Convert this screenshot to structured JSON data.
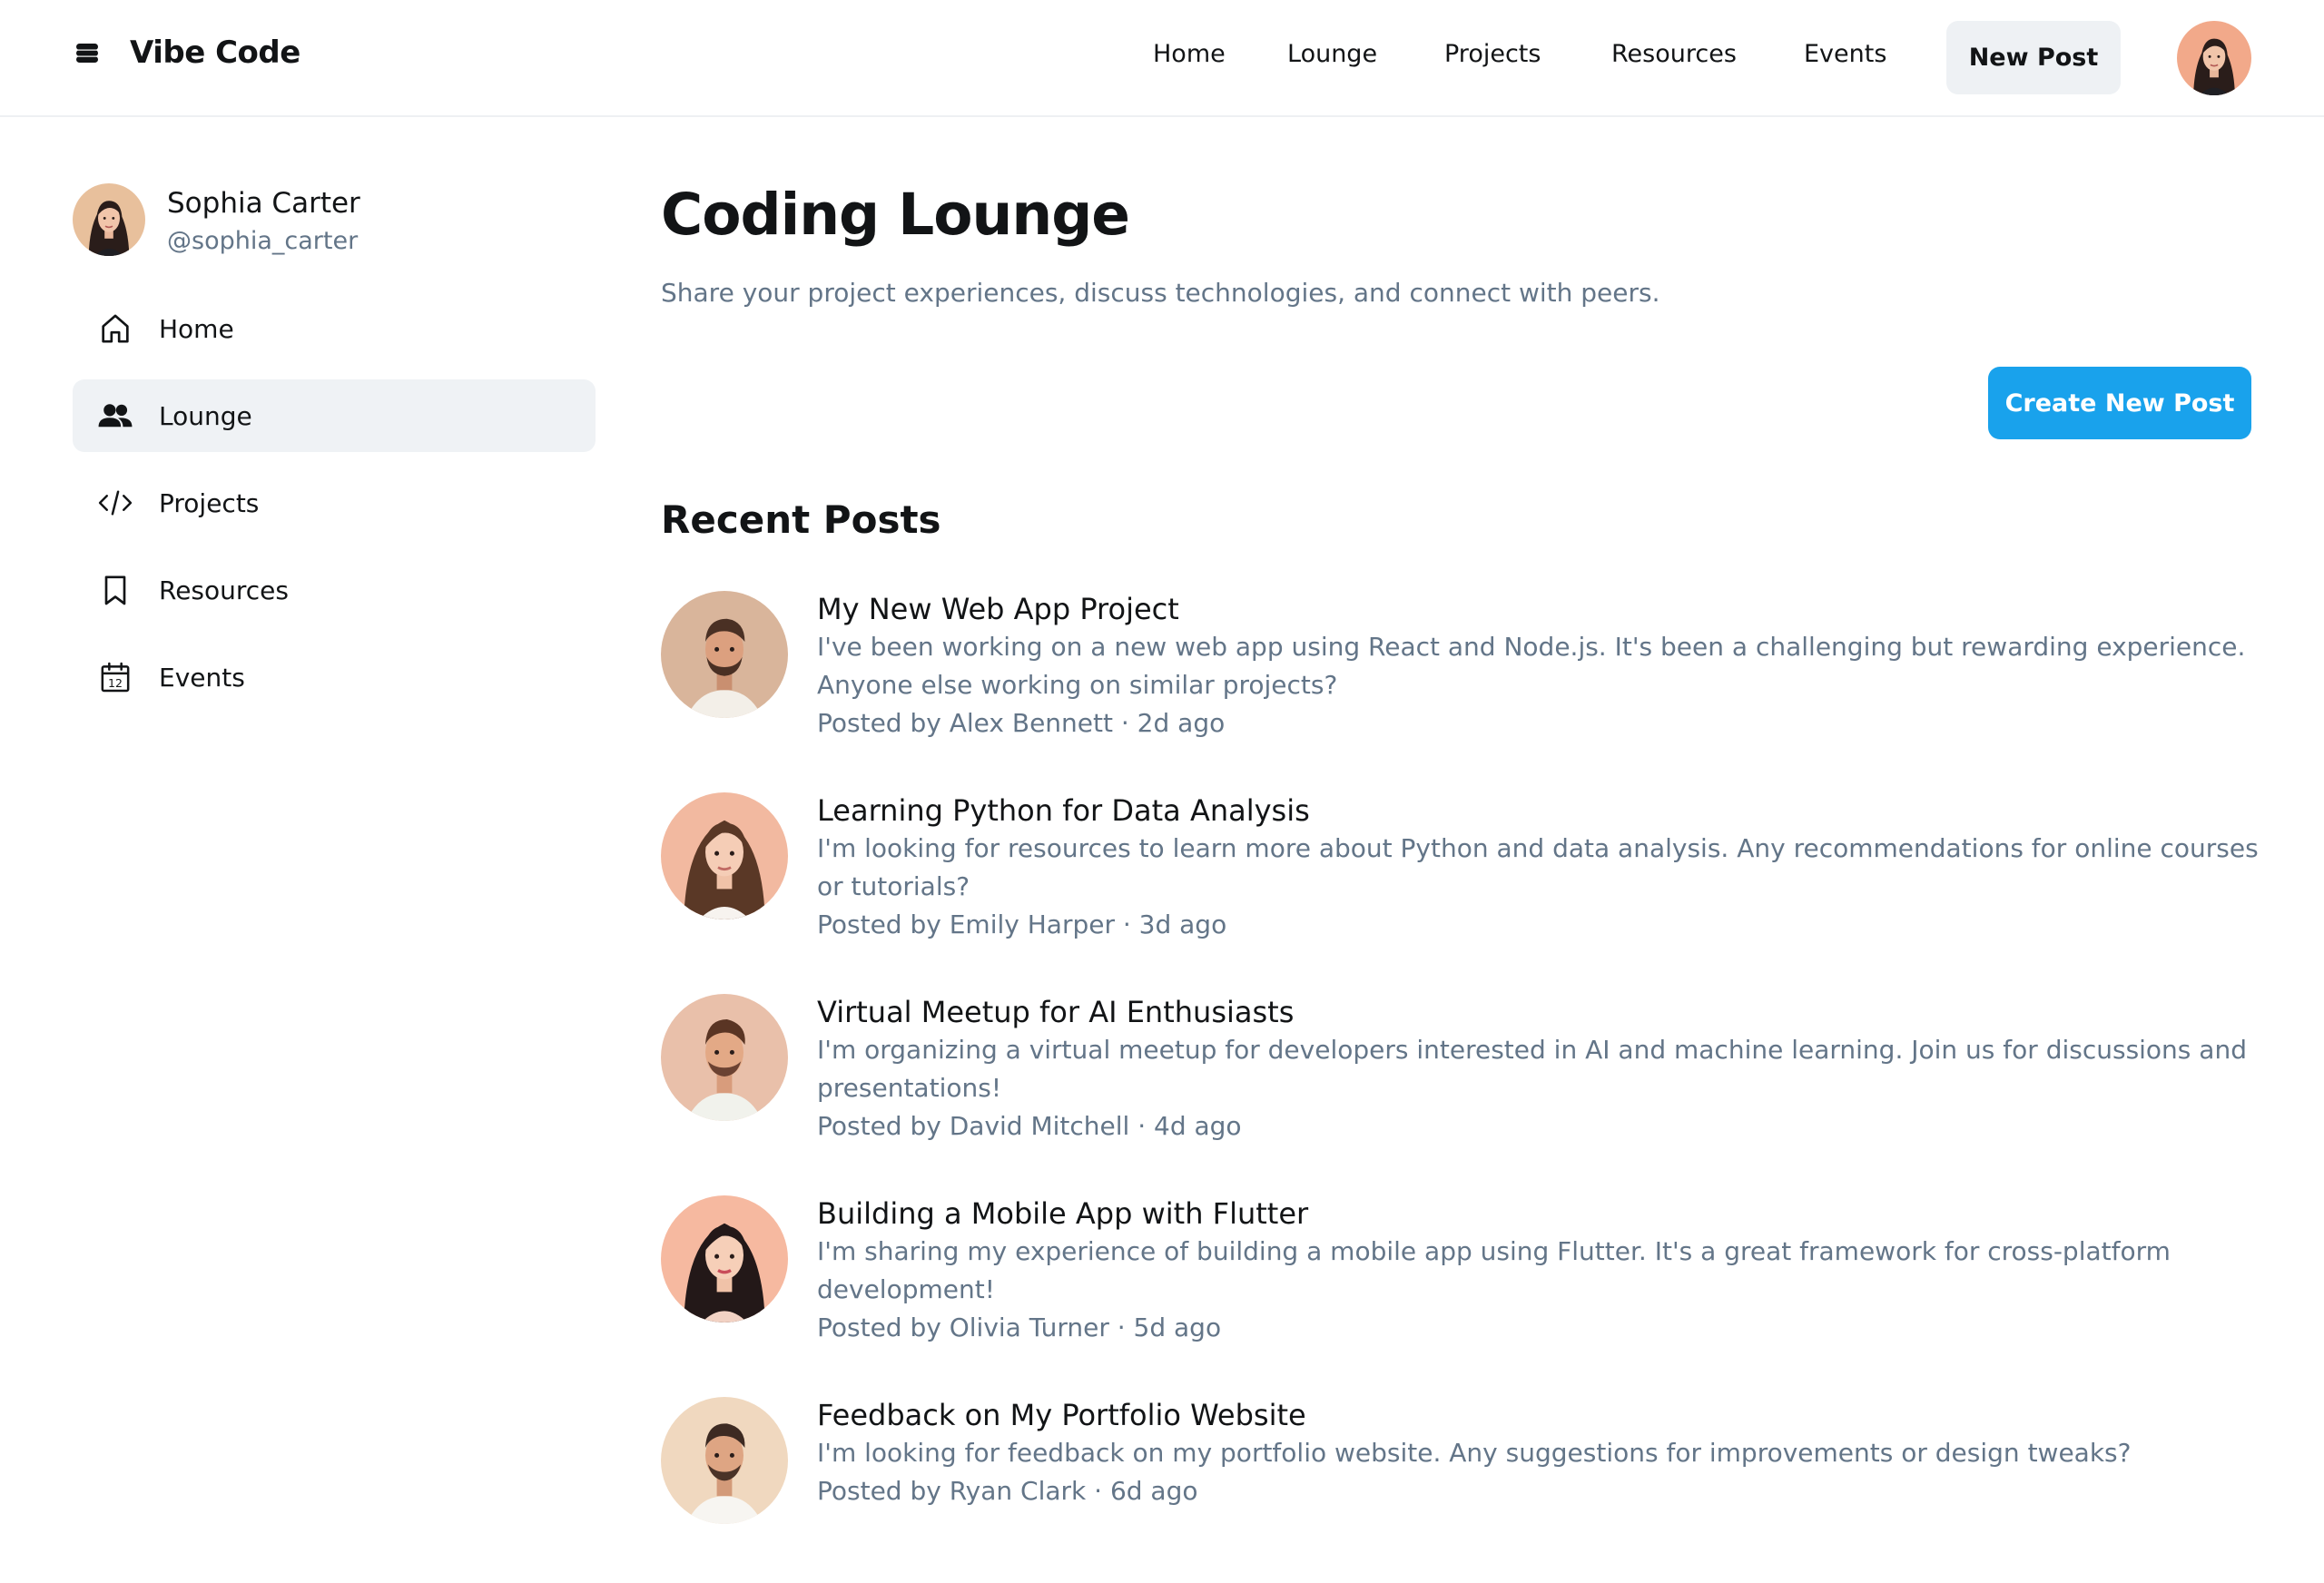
{
  "brand": {
    "name": "Vibe Code"
  },
  "nav": {
    "items": [
      "Home",
      "Lounge",
      "Projects",
      "Resources",
      "Events"
    ],
    "new_post": "New Post"
  },
  "profile": {
    "name": "Sophia Carter",
    "handle": "@sophia_carter"
  },
  "sidebar": {
    "items": [
      {
        "label": "Home",
        "icon": "home-icon"
      },
      {
        "label": "Lounge",
        "icon": "users-icon"
      },
      {
        "label": "Projects",
        "icon": "code-icon"
      },
      {
        "label": "Resources",
        "icon": "bookmark-icon"
      },
      {
        "label": "Events",
        "icon": "calendar-icon",
        "icon_text": "12"
      }
    ],
    "active": "Lounge"
  },
  "main": {
    "title": "Coding Lounge",
    "subtitle": "Share your project experiences, discuss technologies, and connect with peers.",
    "create_button": "Create New Post",
    "section_title": "Recent Posts"
  },
  "posts": [
    {
      "title": "My New Web App Project",
      "text": "I've been working on a new web app using React and Node.js. It's been a challenging but rewarding experience. Anyone else working on similar projects?",
      "meta": "Posted by Alex Bennett · 2d ago"
    },
    {
      "title": "Learning Python for Data Analysis",
      "text": "I'm looking for resources to learn more about Python and data analysis. Any recommendations for online courses or tutorials?",
      "meta": "Posted by Emily Harper · 3d ago"
    },
    {
      "title": "Virtual Meetup for AI Enthusiasts",
      "text": "I'm organizing a virtual meetup for developers interested in AI and machine learning. Join us for discussions and presentations!",
      "meta": "Posted by David Mitchell · 4d ago"
    },
    {
      "title": "Building a Mobile App with Flutter",
      "text": "I'm sharing my experience of building a mobile app using Flutter. It's a great framework for cross-platform development!",
      "meta": "Posted by Olivia Turner · 5d ago"
    },
    {
      "title": "Feedback on My Portfolio Website",
      "text": "I'm looking for feedback on my portfolio website. Any suggestions for improvements or design tweaks?",
      "meta": "Posted by Ryan Clark · 6d ago"
    }
  ],
  "colors": {
    "accent": "#19a2ec",
    "muted_text": "#637588",
    "active_bg": "#eff2f5"
  }
}
